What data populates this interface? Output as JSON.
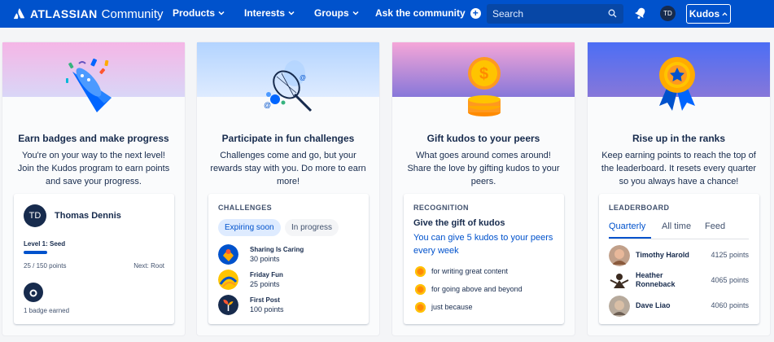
{
  "nav": {
    "brand": "ATLASSIAN",
    "product": "Community",
    "items": [
      {
        "label": "Products"
      },
      {
        "label": "Interests"
      },
      {
        "label": "Groups"
      }
    ],
    "ask_label": "Ask the community",
    "search_placeholder": "Search",
    "user_initials": "TD",
    "kudos_label": "Kudos",
    "colors": {
      "bar": "#0052cc",
      "search": "#0747a6"
    }
  },
  "cards": [
    {
      "title": "Earn badges and make progress",
      "description": "You're on your way to the next level! Join the Kudos program to earn points and save your progress.",
      "panel": {
        "initials": "TD",
        "name": "Thomas Dennis",
        "level": "Level 1: Seed",
        "progress_fraction": 0.1667,
        "points": "25 / 150 points",
        "next": "Next: Root",
        "badges": "1 badge earned"
      }
    },
    {
      "title": "Participate in fun challenges",
      "description": "Challenges come and go, but your rewards stay with you. Do more to earn more!",
      "panel": {
        "header": "CHALLENGES",
        "tabs": [
          "Expiring soon",
          "In progress"
        ],
        "items": [
          {
            "title": "Sharing Is Caring",
            "points": "30 points"
          },
          {
            "title": "Friday Fun",
            "points": "25 points"
          },
          {
            "title": "First Post",
            "points": "100 points"
          }
        ]
      }
    },
    {
      "title": "Gift kudos to your peers",
      "description": "What goes around comes around! Share the love by gifting kudos to your peers.",
      "panel": {
        "header": "RECOGNITION",
        "heading": "Give the gift of kudos",
        "subheading": "You can give 5 kudos to your peers every week",
        "reasons": [
          "for writing great content",
          "for going above and beyond",
          "just because"
        ]
      }
    },
    {
      "title": "Rise up in the ranks",
      "description": "Keep earning points to reach the top of the leaderboard. It resets every quarter so you always have a chance!",
      "panel": {
        "header": "LEADERBOARD",
        "tabs": [
          "Quarterly",
          "All time",
          "Feed"
        ],
        "rows": [
          {
            "name": "Timothy Harold",
            "points": "4125 points"
          },
          {
            "name": "Heather Ronneback",
            "points": "4065 points"
          },
          {
            "name": "Dave Liao",
            "points": "4060 points"
          }
        ]
      }
    }
  ]
}
